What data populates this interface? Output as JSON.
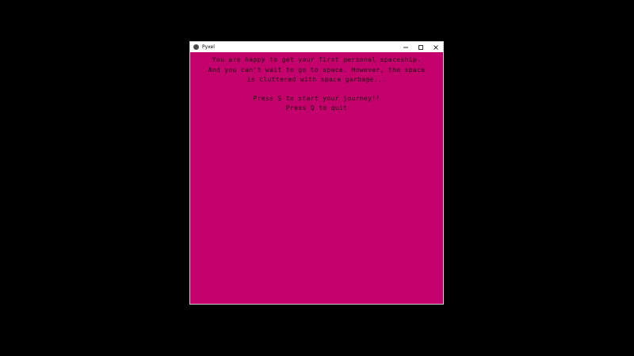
{
  "window": {
    "title": "Pyxel",
    "icon": "pyxel-app-icon",
    "controls": [
      "minimize-icon",
      "maximize-icon",
      "close-icon"
    ]
  },
  "game": {
    "background_color": "#c3006b",
    "text_color": "#1a0010",
    "intro_lines": [
      "You are happy to get your first personal spaceship.",
      "And you can't wait to go to space. However, the space",
      "is cluttered with space garbage..."
    ],
    "start_prompt": "Press S to start your journey!!",
    "quit_prompt": "Press Q to quit"
  }
}
